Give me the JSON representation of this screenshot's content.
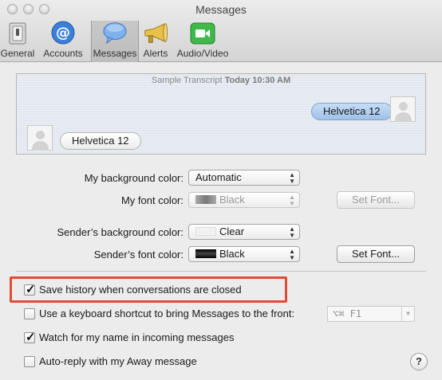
{
  "window": {
    "title": "Messages"
  },
  "toolbar": {
    "items": [
      {
        "label": "General",
        "icon": "general-switch-icon"
      },
      {
        "label": "Accounts",
        "icon": "at-sign-icon"
      },
      {
        "label": "Messages",
        "icon": "speech-bubble-icon",
        "active": true
      },
      {
        "label": "Alerts",
        "icon": "megaphone-icon"
      },
      {
        "label": "Audio/Video",
        "icon": "video-camera-icon"
      }
    ]
  },
  "preview": {
    "header_label": "Sample Transcript",
    "header_time": "Today 10:30 AM",
    "my_bubble": "Helvetica 12",
    "sender_bubble": "Helvetica 12"
  },
  "settings": {
    "my_background": {
      "label": "My background color:",
      "value": "Automatic"
    },
    "my_font": {
      "label": "My font color:",
      "value": "Black",
      "button": "Set Font..."
    },
    "sender_background": {
      "label": "Sender’s background color:",
      "value": "Clear"
    },
    "sender_font": {
      "label": "Sender’s font color:",
      "value": "Black",
      "button": "Set Font..."
    }
  },
  "options": {
    "save_history": {
      "label": "Save history when conversations are closed",
      "checked": true
    },
    "keyboard_shortcut": {
      "label": "Use a keyboard shortcut to bring Messages to the front:",
      "checked": false,
      "shortcut": "⌥⌘ F1"
    },
    "watch_name": {
      "label": "Watch for my name in incoming messages",
      "checked": true
    },
    "auto_reply": {
      "label": "Auto-reply with my Away message",
      "checked": false
    }
  },
  "help_label": "?",
  "colors": {
    "highlight": "#e54a36",
    "bubble_mine": "#b3d0f1",
    "accent_blue": "#3b7fd9"
  }
}
